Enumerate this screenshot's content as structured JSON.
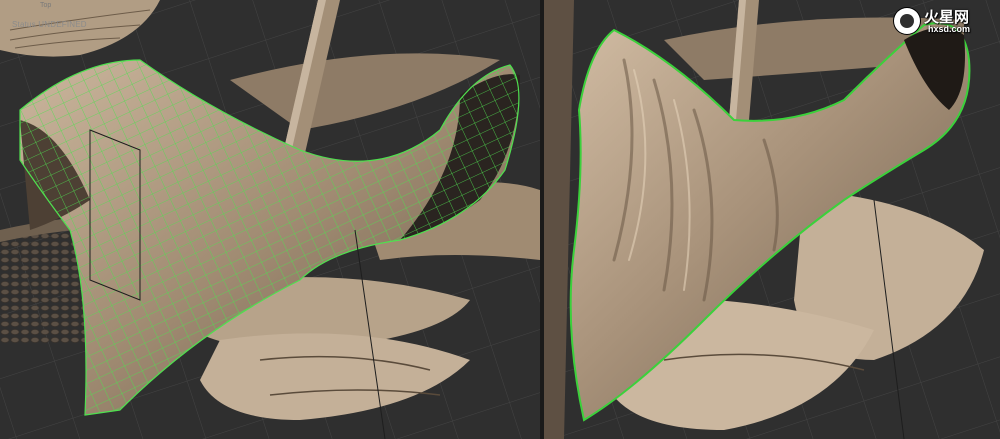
{
  "left_viewport": {
    "status_top": "Top",
    "status_text": "Status UNDEFINED"
  },
  "watermark": {
    "title": "火星网",
    "subtitle": "hxsd.com"
  },
  "colors": {
    "background": "#2f2f2f",
    "grid": "#464646",
    "clay": "#a08b72",
    "clay_light": "#cbb69d",
    "clay_dark": "#5e4f3f",
    "wireframe": "#4fe04f",
    "outline": "#3bd13b"
  }
}
